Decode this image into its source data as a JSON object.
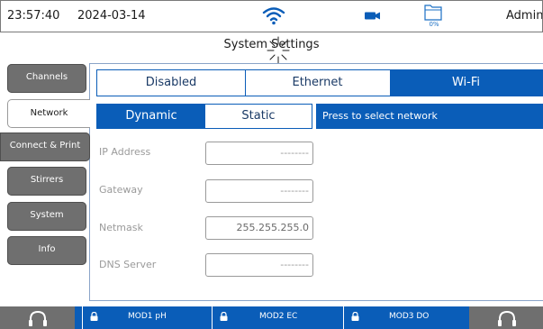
{
  "status_bar": {
    "time": "23:57:40",
    "date": "2024-03-14",
    "wifi_icon": "wifi-icon",
    "camera_icon": "camera-icon",
    "folder_icon": "folder-icon",
    "storage_percent": "0%",
    "user": "Admin"
  },
  "header": {
    "title": "System Settings"
  },
  "sidebar": {
    "items": [
      {
        "label": "Channels",
        "active": false
      },
      {
        "label": "Network",
        "active": true
      },
      {
        "label": "Connect & Print",
        "active": false
      },
      {
        "label": "Stirrers",
        "active": false
      },
      {
        "label": "System",
        "active": false
      },
      {
        "label": "Info",
        "active": false
      }
    ]
  },
  "network": {
    "mode_tabs": [
      {
        "label": "Disabled",
        "selected": false
      },
      {
        "label": "Ethernet",
        "selected": false
      },
      {
        "label": "Wi-Fi",
        "selected": true
      }
    ],
    "ip_tabs": [
      {
        "label": "Dynamic",
        "selected": true
      },
      {
        "label": "Static",
        "selected": false
      }
    ],
    "select_network_label": "Press to select network",
    "fields": [
      {
        "label": "IP Address",
        "value": "--------"
      },
      {
        "label": "Gateway",
        "value": "--------"
      },
      {
        "label": "Netmask",
        "value": "255.255.255.0"
      },
      {
        "label": "DNS Server",
        "value": "--------"
      }
    ]
  },
  "bottom_bar": {
    "modules": [
      {
        "label": "MOD1 pH"
      },
      {
        "label": "MOD2 EC"
      },
      {
        "label": "MOD3 DO"
      }
    ],
    "headset_icon": "headset-icon",
    "lock_icon": "lock-icon"
  },
  "colors": {
    "accent": "#0a5db8",
    "sidebar_button": "#6f6f6f"
  }
}
